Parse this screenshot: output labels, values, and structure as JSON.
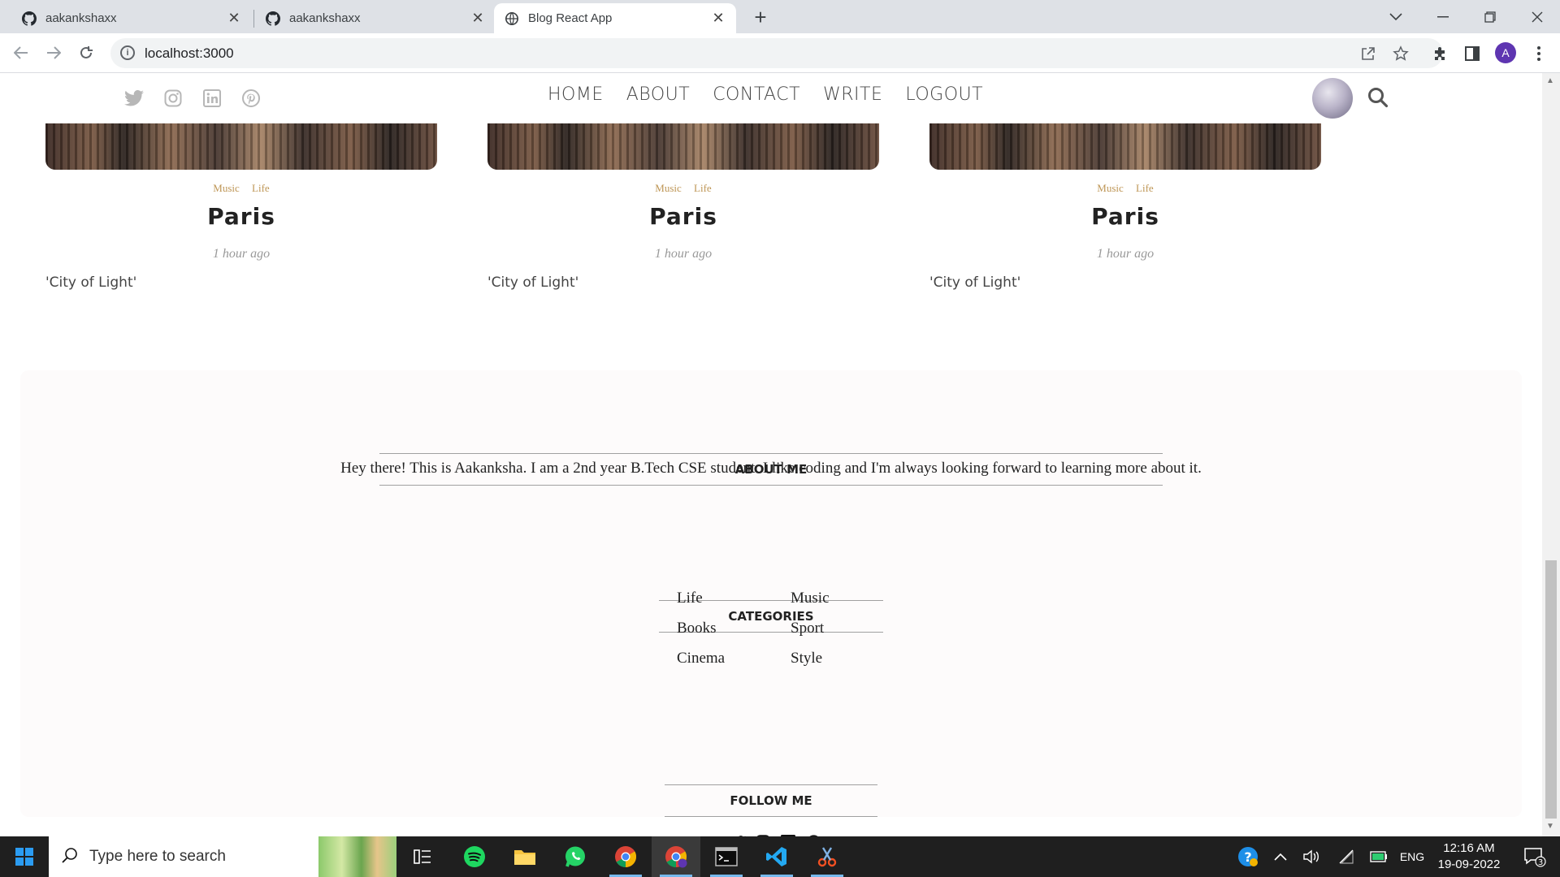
{
  "browser": {
    "tabs": [
      {
        "title": "aakankshaxx"
      },
      {
        "title": "aakankshaxx"
      },
      {
        "title": "Blog React App"
      }
    ],
    "url": "localhost:3000",
    "profile_initial": "A"
  },
  "blog": {
    "nav": {
      "items": [
        "HOME",
        "ABOUT",
        "CONTACT",
        "WRITE",
        "LOGOUT"
      ]
    },
    "posts": [
      {
        "categories": [
          "Music",
          "Life"
        ],
        "title": "Paris",
        "date": "1 hour ago",
        "desc": "'City of Light'"
      },
      {
        "categories": [
          "Music",
          "Life"
        ],
        "title": "Paris",
        "date": "1 hour ago",
        "desc": "'City of Light'"
      },
      {
        "categories": [
          "Music",
          "Life"
        ],
        "title": "Paris",
        "date": "1 hour ago",
        "desc": "'City of Light'"
      }
    ],
    "sidebar": {
      "about_title": "ABOUT ME",
      "about_text": "Hey there! This is Aakanksha. I am a 2nd year B.Tech CSE student. I like coding and I'm always looking forward to learning more about it.",
      "categories_title": "CATEGORIES",
      "categories": [
        "Life",
        "Music",
        "Books",
        "Sport",
        "Cinema",
        "Style"
      ],
      "follow_title": "FOLLOW ME"
    }
  },
  "taskbar": {
    "search_placeholder": "Type here to search",
    "language": "ENG",
    "time": "12:16 AM",
    "date": "19-09-2022",
    "notification_count": "3"
  }
}
